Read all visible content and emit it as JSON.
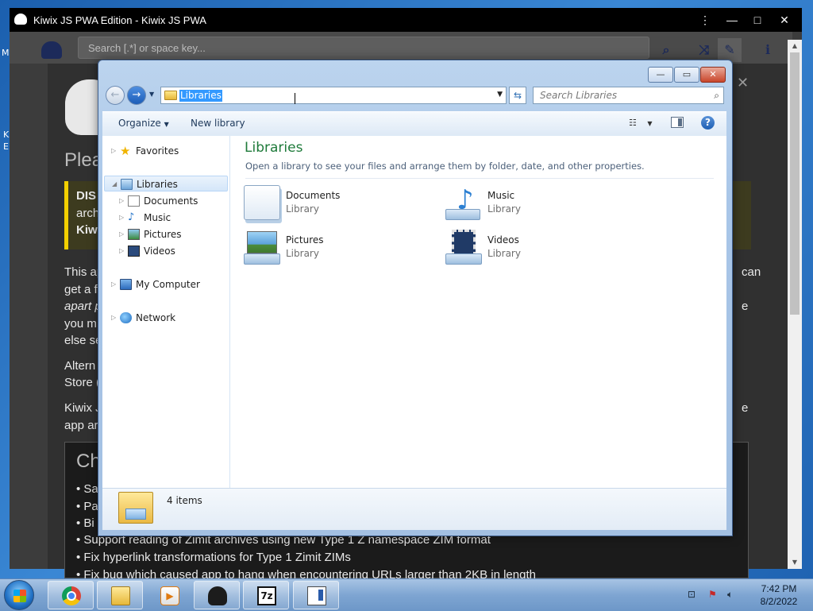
{
  "background_app": {
    "title": "Kiwix JS PWA Edition - Kiwix JS PWA",
    "controls": {
      "menu": "⋮",
      "minimize": "—",
      "maximize": "□",
      "close": "✕"
    },
    "search_placeholder": "Search [.*] or space key...",
    "content_lines": [
      "Plea",
      "DIS",
      "arch",
      "Kiw",
      "This ap",
      "get a f",
      "apart p",
      "you m",
      "else se",
      "Altern",
      "Store (",
      "Kiwix J",
      "app ar",
      "Ch",
      "Sa",
      "Pa",
      "Bi",
      "Support reading of Zimit archives using new Type 1 Z namespace ZIM format",
      "Fix hyperlink transformations for Type 1 Zimit ZIMs",
      "Fix bug which caused app to hang when encountering URLs larger than 2KB in length"
    ],
    "right_fragments": [
      "can",
      "e",
      "e"
    ],
    "desktop_letters": [
      "M",
      "K",
      "E"
    ]
  },
  "explorer": {
    "address": "Libraries",
    "search_placeholder": "Search Libraries",
    "toolbar": {
      "organize": "Organize",
      "new_library": "New library"
    },
    "nav": {
      "favorites": "Favorites",
      "libraries": "Libraries",
      "documents": "Documents",
      "music": "Music",
      "pictures": "Pictures",
      "videos": "Videos",
      "computer": "My Computer",
      "network": "Network"
    },
    "content": {
      "title": "Libraries",
      "subtitle": "Open a library to see your files and arrange them by folder, date, and other properties.",
      "items": [
        {
          "name": "Documents",
          "type": "Library",
          "icon": "documents-library-icon"
        },
        {
          "name": "Music",
          "type": "Library",
          "icon": "music-library-icon"
        },
        {
          "name": "Pictures",
          "type": "Library",
          "icon": "pictures-library-icon"
        },
        {
          "name": "Videos",
          "type": "Library",
          "icon": "videos-library-icon"
        }
      ]
    },
    "details": {
      "count": "4 items"
    }
  },
  "taskbar": {
    "apps": [
      "chrome-icon",
      "explorer-folder-icon",
      "media-player-icon",
      "kiwix-icon",
      "7zip-icon",
      "notepad-icon"
    ],
    "seven_zip_label": "7z",
    "clock": {
      "time": "7:42 PM",
      "date": "8/2/2022"
    }
  }
}
